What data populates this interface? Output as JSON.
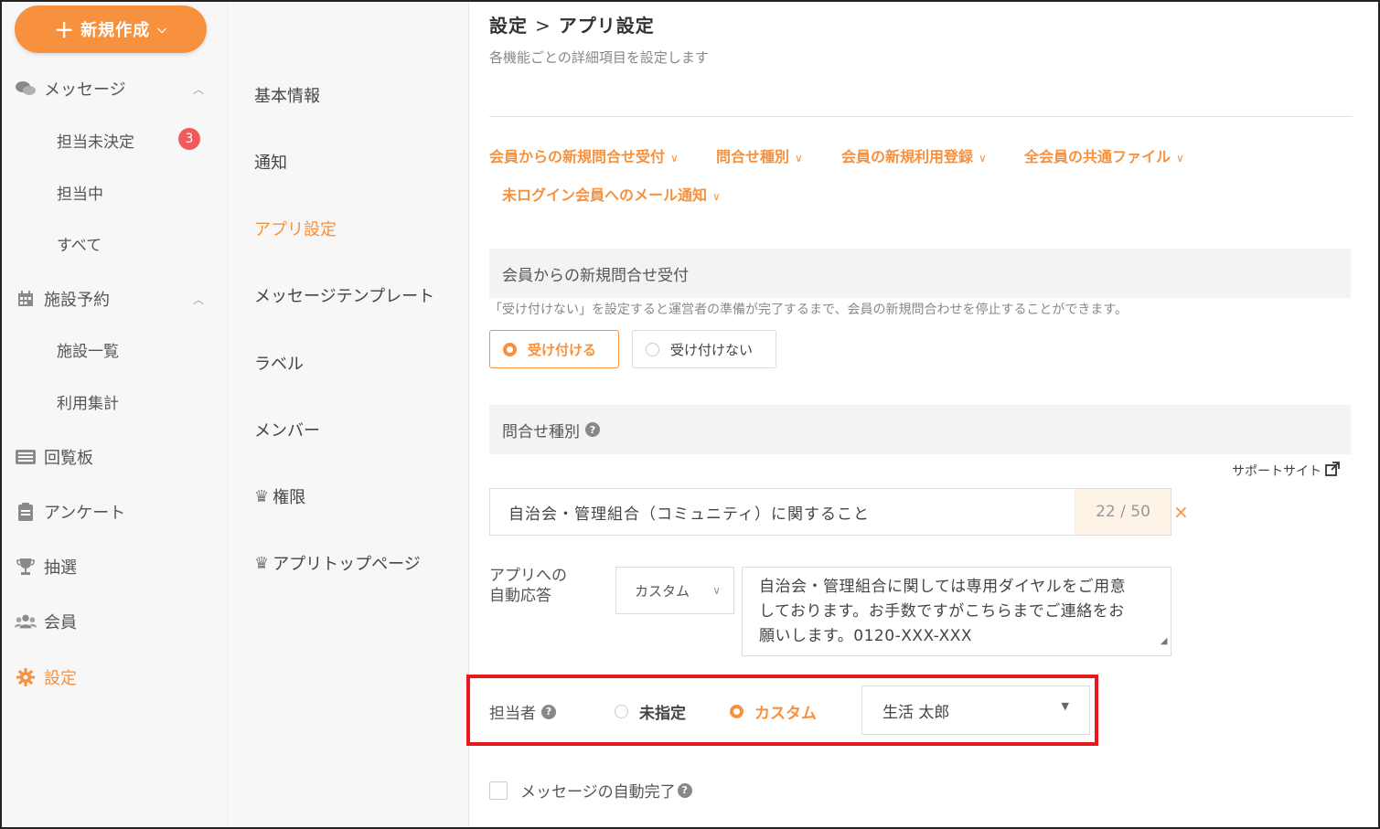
{
  "sidebar": {
    "new_button_label": "新規作成",
    "items": [
      {
        "label": "メッセージ",
        "icon": "chat-icon"
      },
      {
        "label": "担当未決定",
        "badge": "3"
      },
      {
        "label": "担当中"
      },
      {
        "label": "すべて"
      },
      {
        "label": "施設予約",
        "icon": "calendar-icon"
      },
      {
        "label": "施設一覧"
      },
      {
        "label": "利用集計"
      },
      {
        "label": "回覧板",
        "icon": "board-icon"
      },
      {
        "label": "アンケート",
        "icon": "clipboard-icon"
      },
      {
        "label": "抽選",
        "icon": "trophy-icon"
      },
      {
        "label": "会員",
        "icon": "users-icon"
      },
      {
        "label": "設定",
        "icon": "gear-icon"
      }
    ]
  },
  "settings_menu": {
    "items": [
      "基本情報",
      "通知",
      "アプリ設定",
      "メッセージテンプレート",
      "ラベル",
      "メンバー",
      "権限",
      "アプリトップページ"
    ],
    "active": "アプリ設定"
  },
  "header": {
    "crumb_parent": "設定",
    "crumb_sep": ">",
    "crumb_current": "アプリ設定",
    "subtitle": "各機能ごとの詳細項目を設定します"
  },
  "anchors": [
    "会員からの新規問合せ受付",
    "問合せ種別",
    "会員の新規利用登録",
    "全会員の共通ファイル",
    "未ログイン会員へのメール通知"
  ],
  "section1": {
    "title": "会員からの新規問合せ受付",
    "note": "「受け付けない」を設定すると運営者の準備が完了するまで、会員の新規問合わせを停止することができます。",
    "option_accept": "受け付ける",
    "option_reject": "受け付けない"
  },
  "section2": {
    "title": "問合せ種別",
    "support_link": "サポートサイト",
    "type_value": "自治会・管理組合（コミュニティ）に関すること",
    "counter": "22 / 50",
    "clear": "×",
    "auto_reply_label_1": "アプリへの",
    "auto_reply_label_2": "自動応答",
    "auto_reply_select": "カスタム",
    "auto_reply_text_1": "自治会・管理組合に関しては専用ダイヤルをご用意",
    "auto_reply_text_2": "しております。お手数ですがこちらまでご連絡をお",
    "auto_reply_text_3": "願いします。0120-XXX-XXX",
    "assignee_label": "担当者",
    "assignee_unassigned": "未指定",
    "assignee_custom": "カスタム",
    "assignee_value": "生活 太郎",
    "auto_complete_label": "メッセージの自動完了"
  },
  "colors": {
    "accent": "#f7913d",
    "highlight": "#e8181f",
    "badge": "#f05a5a"
  }
}
